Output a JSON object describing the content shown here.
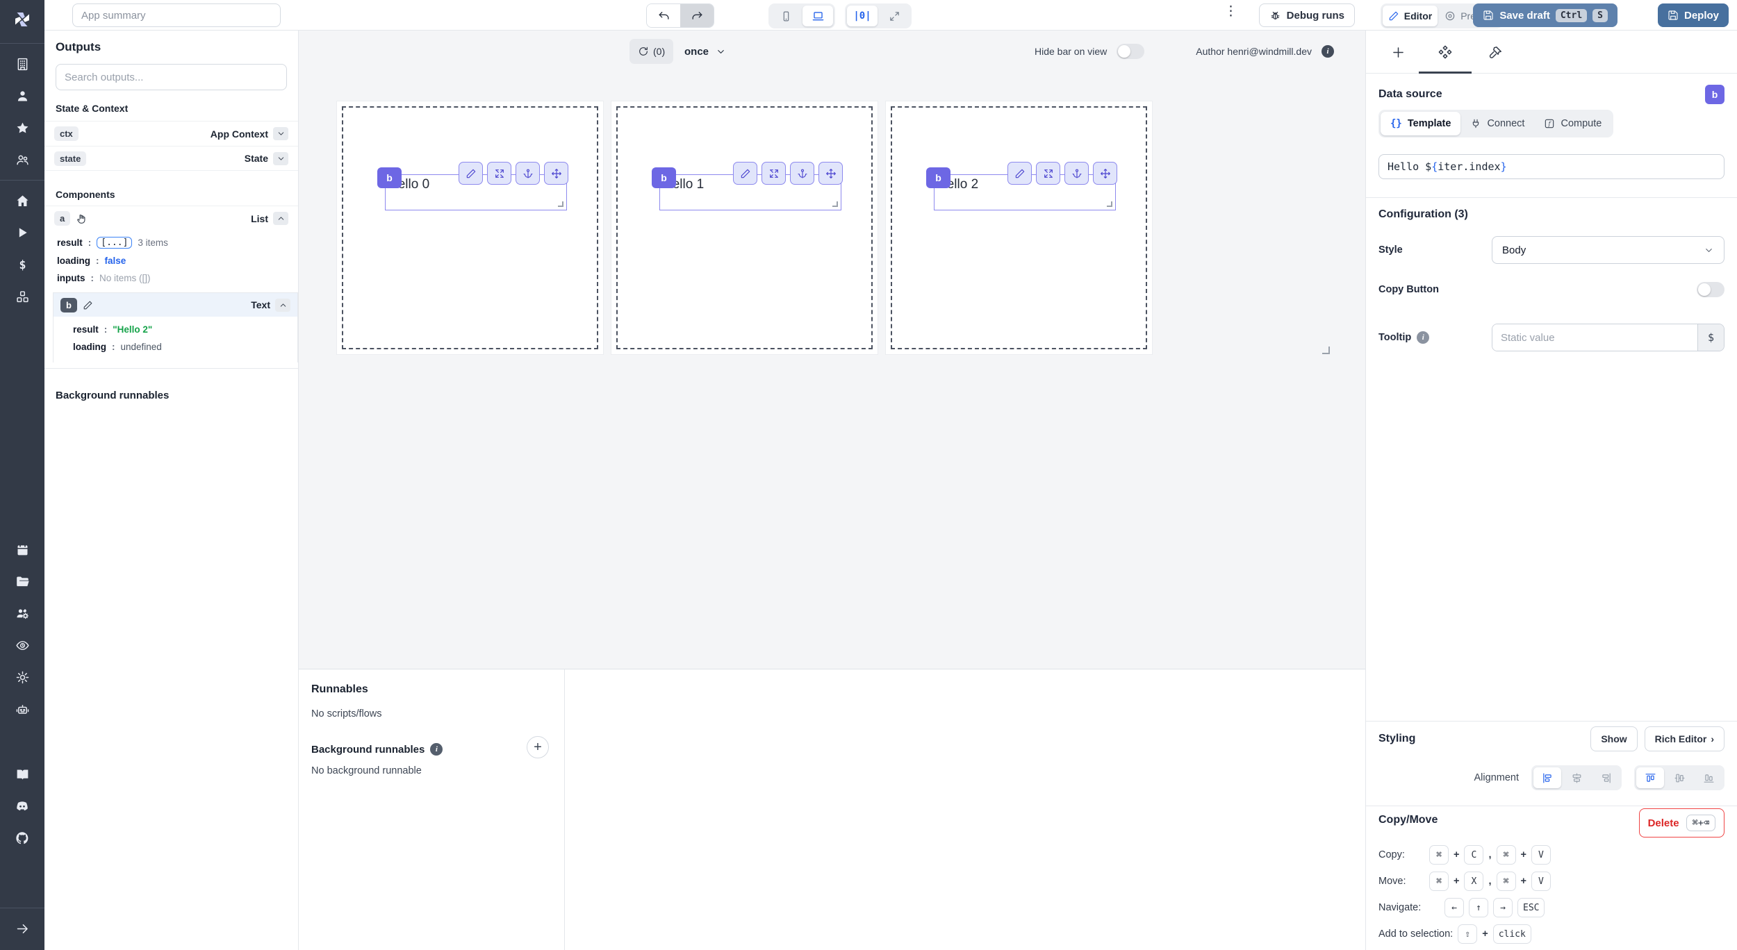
{
  "colors": {
    "accent_indigo": "#6d67e4",
    "accent_blue": "#2563eb",
    "save_draft_bg": "#5e81ac",
    "deploy_bg": "#47709e",
    "delete_red": "#dc2626",
    "result_green": "#16a34a",
    "rail_bg": "#333a47"
  },
  "header": {
    "app_summary_placeholder": "App summary",
    "center_align_glyph": "|0|",
    "debug_runs": "Debug runs",
    "editor": "Editor",
    "preview": "Preview",
    "save_draft": "Save draft",
    "kbd_ctrl": "Ctrl",
    "kbd_s": "S",
    "deploy": "Deploy"
  },
  "outputs_panel": {
    "title": "Outputs",
    "search_placeholder": "Search outputs...",
    "colon": ":",
    "state_context": {
      "title": "State & Context",
      "ctx_badge": "ctx",
      "ctx_type": "App Context",
      "state_badge": "state",
      "state_type": "State"
    },
    "components": {
      "title": "Components",
      "a_badge": "a",
      "a_type": "List",
      "a_result_key": "result",
      "a_result_chip": "[...]",
      "a_result_extra": "3 items",
      "a_loading_key": "loading",
      "a_loading_val": "false",
      "a_inputs_key": "inputs",
      "a_inputs_val": "No items ([])",
      "b_badge": "b",
      "b_type": "Text",
      "b_result_key": "result",
      "b_result_val": "\"Hello 2\"",
      "b_loading_key": "loading",
      "b_loading_val": "undefined"
    },
    "background_runnables_title": "Background runnables"
  },
  "canvas": {
    "refresh_count": "(0)",
    "refresh_mode": "once",
    "hide_bar_label": "Hide bar on view",
    "author": "Author henri@windmill.dev",
    "items": [
      {
        "badge": "b",
        "text": "Hello 0"
      },
      {
        "badge": "b",
        "text": "Hello 1"
      },
      {
        "badge": "b",
        "text": "Hello 2"
      }
    ]
  },
  "runnables_panel": {
    "title": "Runnables",
    "empty": "No scripts/flows",
    "bg_title": "Background runnables",
    "bg_empty": "No background runnable"
  },
  "settings_panel": {
    "data_source_title": "Data source",
    "component_badge": "b",
    "tabs": {
      "template_braces": "{}",
      "template": "Template",
      "connect": "Connect",
      "compute": "Compute"
    },
    "template_parts": {
      "p1": "Hello $",
      "p2": "{",
      "p3": "iter.index",
      "p4": "}"
    },
    "configuration_title": "Configuration (3)",
    "style_label": "Style",
    "style_value": "Body",
    "copy_button_label": "Copy Button",
    "tooltip_label": "Tooltip",
    "tooltip_placeholder": "Static value",
    "tooltip_button": "$",
    "styling": {
      "title": "Styling",
      "show": "Show",
      "rich_editor": "Rich Editor",
      "chevron": "›"
    },
    "alignment_label": "Alignment",
    "copy_move": {
      "title": "Copy/Move",
      "delete_label": "Delete",
      "delete_kbd": "⌘+⌫",
      "copy_label": "Copy:",
      "move_label": "Move:",
      "navigate_label": "Navigate:",
      "add_label": "Add to selection:",
      "cmd": "⌘",
      "plus": "+",
      "comma": ",",
      "key_c": "C",
      "key_v": "V",
      "key_x": "X",
      "key_left": "←",
      "key_up": "↑",
      "key_right": "→",
      "key_esc": "ESC",
      "shift": "⇧",
      "click": "click"
    }
  }
}
